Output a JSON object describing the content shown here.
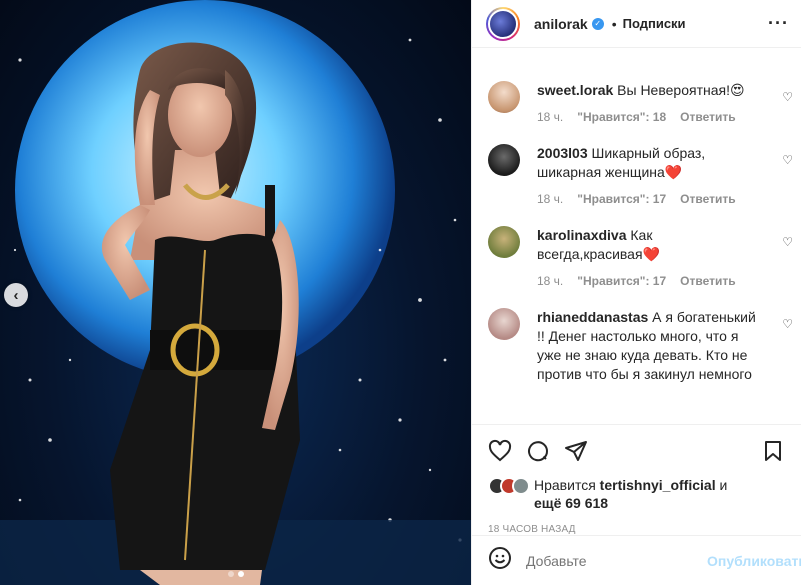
{
  "header": {
    "username": "anilorak",
    "separator": "•",
    "follow_label": "Подписки",
    "more_icon": "more-horizontal-icon"
  },
  "comments": [
    {
      "username": "sweet.lorak",
      "text": "Вы Невероятная!",
      "emoji": "😍",
      "time": "18 ч.",
      "likes": "\"Нравится\": 18",
      "reply": "Ответить",
      "avatar_color": "#d9b49a"
    },
    {
      "username": "2003l03",
      "text": "Шикарный образ, шикарная женщина",
      "emoji": "❤️",
      "time": "18 ч.",
      "likes": "\"Нравится\": 17",
      "reply": "Ответить",
      "avatar_color": "#2b2b2b"
    },
    {
      "username": "karolinaxdiva",
      "text": "Как всегда,красивая",
      "emoji": "❤️",
      "time": "18 ч.",
      "likes": "\"Нравится\": 17",
      "reply": "Ответить",
      "avatar_color": "#8a9a5b"
    },
    {
      "username": "rhianeddanastas",
      "text": "А я богатенький !! Денег настолько много, что я уже не знаю куда девать. Кто не против что бы я закинул немного",
      "avatar_color": "#c9a7a0"
    }
  ],
  "likes": {
    "prefix": "Нравится",
    "user": "tertishnyi_official",
    "and": "и",
    "more": "ещё 69 618"
  },
  "timestamp": "18 ЧАСОВ НАЗАД",
  "add_comment": {
    "placeholder": "Добавьте",
    "publish": "Опубликовать"
  },
  "colors": {
    "accent": "#3897f0",
    "muted": "#8e8e8e",
    "publish_disabled": "#b2dffc"
  }
}
